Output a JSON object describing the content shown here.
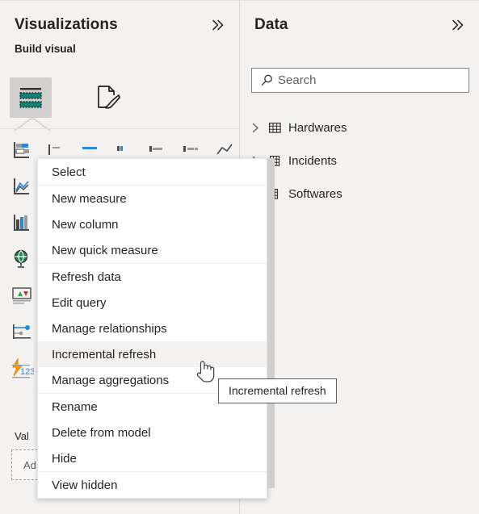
{
  "visualizations_panel": {
    "title": "Visualizations",
    "collapse_icon": "chevron-double-right-icon",
    "build_visual_label": "Build visual",
    "tabs": [
      {
        "name": "build-visual",
        "icon": "stacked-bars-icon",
        "selected": true
      },
      {
        "name": "format-visual",
        "icon": "paintbrush-page-icon",
        "selected": false
      }
    ],
    "gallery_rows": [
      [
        "stacked-bar-chart-icon",
        "clustered-bar-chart-icon",
        "stacked-column-chart-icon",
        "clustered-column-chart-icon",
        "hundred-stacked-bar-icon",
        "hundred-stacked-column-icon",
        "line-chart-icon"
      ],
      [
        "area-chart-icon",
        "stacked-area-chart-icon",
        "line-stacked-column-icon",
        "line-clustered-column-icon",
        "ribbon-chart-icon",
        "waterfall-chart-icon",
        "scatter-chart-icon"
      ],
      [
        "pie-chart-icon",
        "donut-chart-icon",
        "treemap-icon",
        "map-icon",
        "filled-map-icon",
        "funnel-chart-icon",
        "gauge-icon"
      ],
      [
        "globe-map-icon",
        "card-icon",
        "multi-row-card-icon",
        "kpi-icon",
        "slicer-icon",
        "table-icon",
        "matrix-icon"
      ],
      [
        "kpi-arrows-icon",
        "r-script-visual-icon",
        "python-visual-icon",
        "key-influencers-icon",
        "decomposition-tree-icon",
        "qa-visual-icon",
        "smart-narrative-icon"
      ],
      [
        "slicer-list-icon",
        "paginated-report-icon",
        "power-apps-icon",
        "arcgis-maps-icon",
        "get-more-visuals-icon",
        "azure-map-icon",
        "narrative-icon"
      ],
      [
        "fx-123-icon",
        "performance-icon",
        "scorecard-icon",
        "metrics-icon",
        "goal-icon",
        "anomaly-icon",
        "forecast-icon"
      ]
    ],
    "values_label": "Val",
    "values_placeholder": "Ad"
  },
  "data_panel": {
    "title": "Data",
    "collapse_icon": "chevron-double-right-icon",
    "search": {
      "icon": "search-icon",
      "placeholder": "Search",
      "value": ""
    },
    "tables": [
      {
        "label": "Hardwares",
        "icon": "table-grid-icon",
        "chevron": "chevron-right-icon",
        "expandable": true
      },
      {
        "label": "Incidents",
        "icon": "table-grid-icon",
        "chevron": "chevron-right-icon",
        "expandable": true
      },
      {
        "label": "Softwares",
        "icon": "table-column-icon",
        "chevron": "",
        "expandable": false
      }
    ]
  },
  "context_menu": {
    "items": [
      {
        "label": "Select",
        "separator_after": true,
        "highlighted": false
      },
      {
        "label": "New measure",
        "separator_after": false,
        "highlighted": false
      },
      {
        "label": "New column",
        "separator_after": false,
        "highlighted": false
      },
      {
        "label": "New quick measure",
        "separator_after": true,
        "highlighted": false
      },
      {
        "label": "Refresh data",
        "separator_after": false,
        "highlighted": false
      },
      {
        "label": "Edit query",
        "separator_after": false,
        "highlighted": false
      },
      {
        "label": "Manage relationships",
        "separator_after": false,
        "highlighted": false
      },
      {
        "label": "Incremental refresh",
        "separator_after": false,
        "highlighted": true
      },
      {
        "label": "Manage aggregations",
        "separator_after": true,
        "highlighted": false
      },
      {
        "label": "Rename",
        "separator_after": false,
        "highlighted": false
      },
      {
        "label": "Delete from model",
        "separator_after": false,
        "highlighted": false
      },
      {
        "label": "Hide",
        "separator_after": true,
        "highlighted": false
      },
      {
        "label": "View hidden",
        "separator_after": false,
        "highlighted": false
      }
    ]
  },
  "tooltip": {
    "text": "Incremental refresh"
  },
  "cursor": {
    "type": "pointing-hand-cursor"
  },
  "colors": {
    "panel_background": "#f3f2f1",
    "menu_background": "#ffffff",
    "menu_highlight": "#f3f2f1",
    "text_primary": "#252423",
    "accent_teal": "#118074",
    "accent_blue": "#2b88d8",
    "border": "#e1dfdd"
  }
}
